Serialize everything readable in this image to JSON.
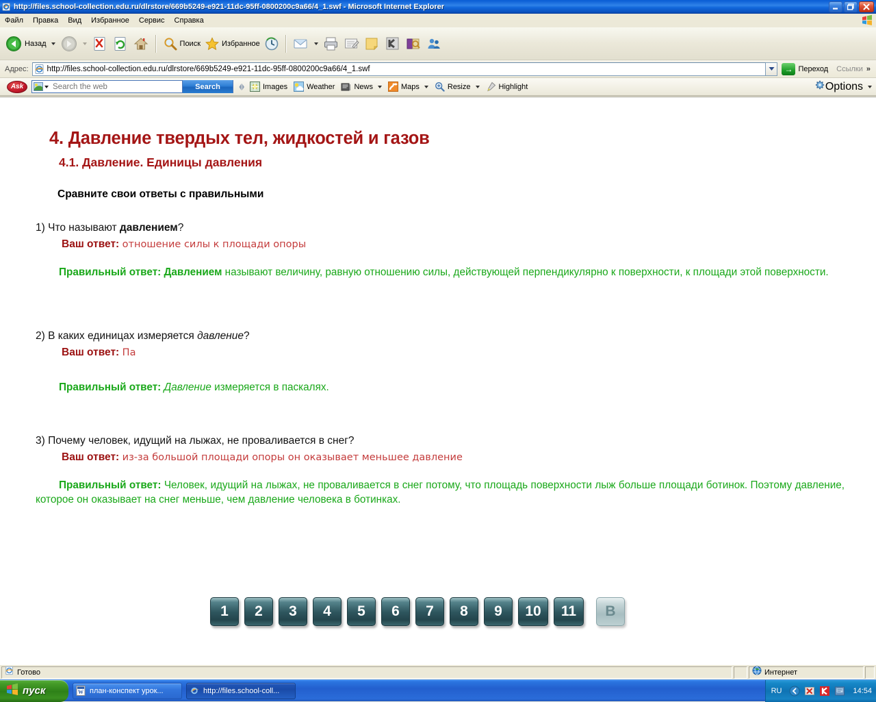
{
  "window": {
    "title": "http://files.school-collection.edu.ru/dlrstore/669b5249-e921-11dc-95ff-0800200c9a66/4_1.swf - Microsoft Internet Explorer",
    "minimize_label": "_",
    "restore_label": "❐",
    "close_label": "✕"
  },
  "menubar": {
    "items": [
      {
        "label": "Файл"
      },
      {
        "label": "Правка"
      },
      {
        "label": "Вид"
      },
      {
        "label": "Избранное"
      },
      {
        "label": "Сервис"
      },
      {
        "label": "Справка"
      }
    ]
  },
  "toolbar": {
    "back_label": "Назад",
    "forward_label": "",
    "stop_label": "",
    "refresh_label": "",
    "home_label": "",
    "search_label": "Поиск",
    "favorites_label": "Избранное",
    "history_label": "",
    "mail_label": "",
    "print_label": "",
    "edit_label": "",
    "notes_label": "",
    "k_label": "",
    "encarta_label": "",
    "messenger_label": ""
  },
  "address": {
    "label": "Адрес:",
    "url": "http://files.school-collection.edu.ru/dlrstore/669b5249-e921-11dc-95ff-0800200c9a66/4_1.swf",
    "go_label": "Переход",
    "go_icon": "→",
    "links_label": "Ссылки",
    "links_chevron": "»"
  },
  "ask_toolbar": {
    "brand": "Ask",
    "search_value": "",
    "search_placeholder": "Search the web",
    "search_button": "Search",
    "items": [
      {
        "label": "Images",
        "has_caret": false
      },
      {
        "label": "Weather",
        "has_caret": false
      },
      {
        "label": "News",
        "has_caret": true
      },
      {
        "label": "Maps",
        "has_caret": true
      },
      {
        "label": "Resize",
        "has_caret": true
      },
      {
        "label": "Highlight",
        "has_caret": false
      }
    ],
    "options_label": "Options"
  },
  "document": {
    "title": "4. Давление твердых тел, жидкостей и газов",
    "subtitle": "4.1. Давление. Единицы давления",
    "instruction": "Сравните свои ответы с правильными",
    "your_answer_label": "Ваш ответ:",
    "correct_answer_label": "Правильный ответ:",
    "questions": [
      {
        "number": "1)",
        "text_before": "Что называют ",
        "emphasis": "давлением",
        "emphasis_style": "bold",
        "text_after": "?",
        "your_answer": "отношение силы к площади опоры",
        "correct_emphasis": "Давлением",
        "correct_emphasis_style": "bold",
        "correct_text": " называют величину, равную отношению силы, действующей перпендикулярно к поверхности, к площади этой поверхности."
      },
      {
        "number": "2)",
        "text_before": "В каких единицах измеряется ",
        "emphasis": "давление",
        "emphasis_style": "italic",
        "text_after": "?",
        "your_answer": "Па",
        "correct_emphasis": "Давление",
        "correct_emphasis_style": "italic",
        "correct_text": " измеряется в паскалях."
      },
      {
        "number": "3)",
        "text_before": "Почему человек, идущий на лыжах, не проваливается в снег?",
        "emphasis": "",
        "emphasis_style": "none",
        "text_after": "",
        "your_answer": "из-за большой площади опоры он оказывает меньшее давление",
        "correct_emphasis": "",
        "correct_emphasis_style": "none",
        "correct_text": "Человек, идущий на лыжах, не проваливается в снег потому, что площадь поверхности лыж больше площади ботинок. Поэтому давление, которое он оказывает на снег меньше, чем давление человека в ботинках."
      }
    ],
    "nav_buttons": [
      {
        "label": "1",
        "active": false
      },
      {
        "label": "2",
        "active": false
      },
      {
        "label": "3",
        "active": false
      },
      {
        "label": "4",
        "active": false
      },
      {
        "label": "5",
        "active": false
      },
      {
        "label": "6",
        "active": false
      },
      {
        "label": "7",
        "active": false
      },
      {
        "label": "8",
        "active": false
      },
      {
        "label": "9",
        "active": false
      },
      {
        "label": "10",
        "active": false
      },
      {
        "label": "11",
        "active": false
      },
      {
        "label": "В",
        "active": true
      }
    ]
  },
  "statusbar": {
    "status_text": "Готово",
    "zone_text": "Интернет"
  },
  "taskbar": {
    "start_label": "пуск",
    "items": [
      {
        "label": "план-конспект урок...",
        "active": false,
        "icon": "word-icon"
      },
      {
        "label": "http://files.school-coll...",
        "active": true,
        "icon": "ie-icon"
      }
    ],
    "language": "RU",
    "clock": "14:54"
  },
  "colors": {
    "title_red": "#a41515",
    "answer_red": "#c43c3c",
    "label_red": "#9b1111",
    "correct_green": "#1aa81a",
    "titlebar_blue": "#1268dc",
    "taskbar_blue": "#235fce",
    "button_teal": "#2e565e"
  }
}
